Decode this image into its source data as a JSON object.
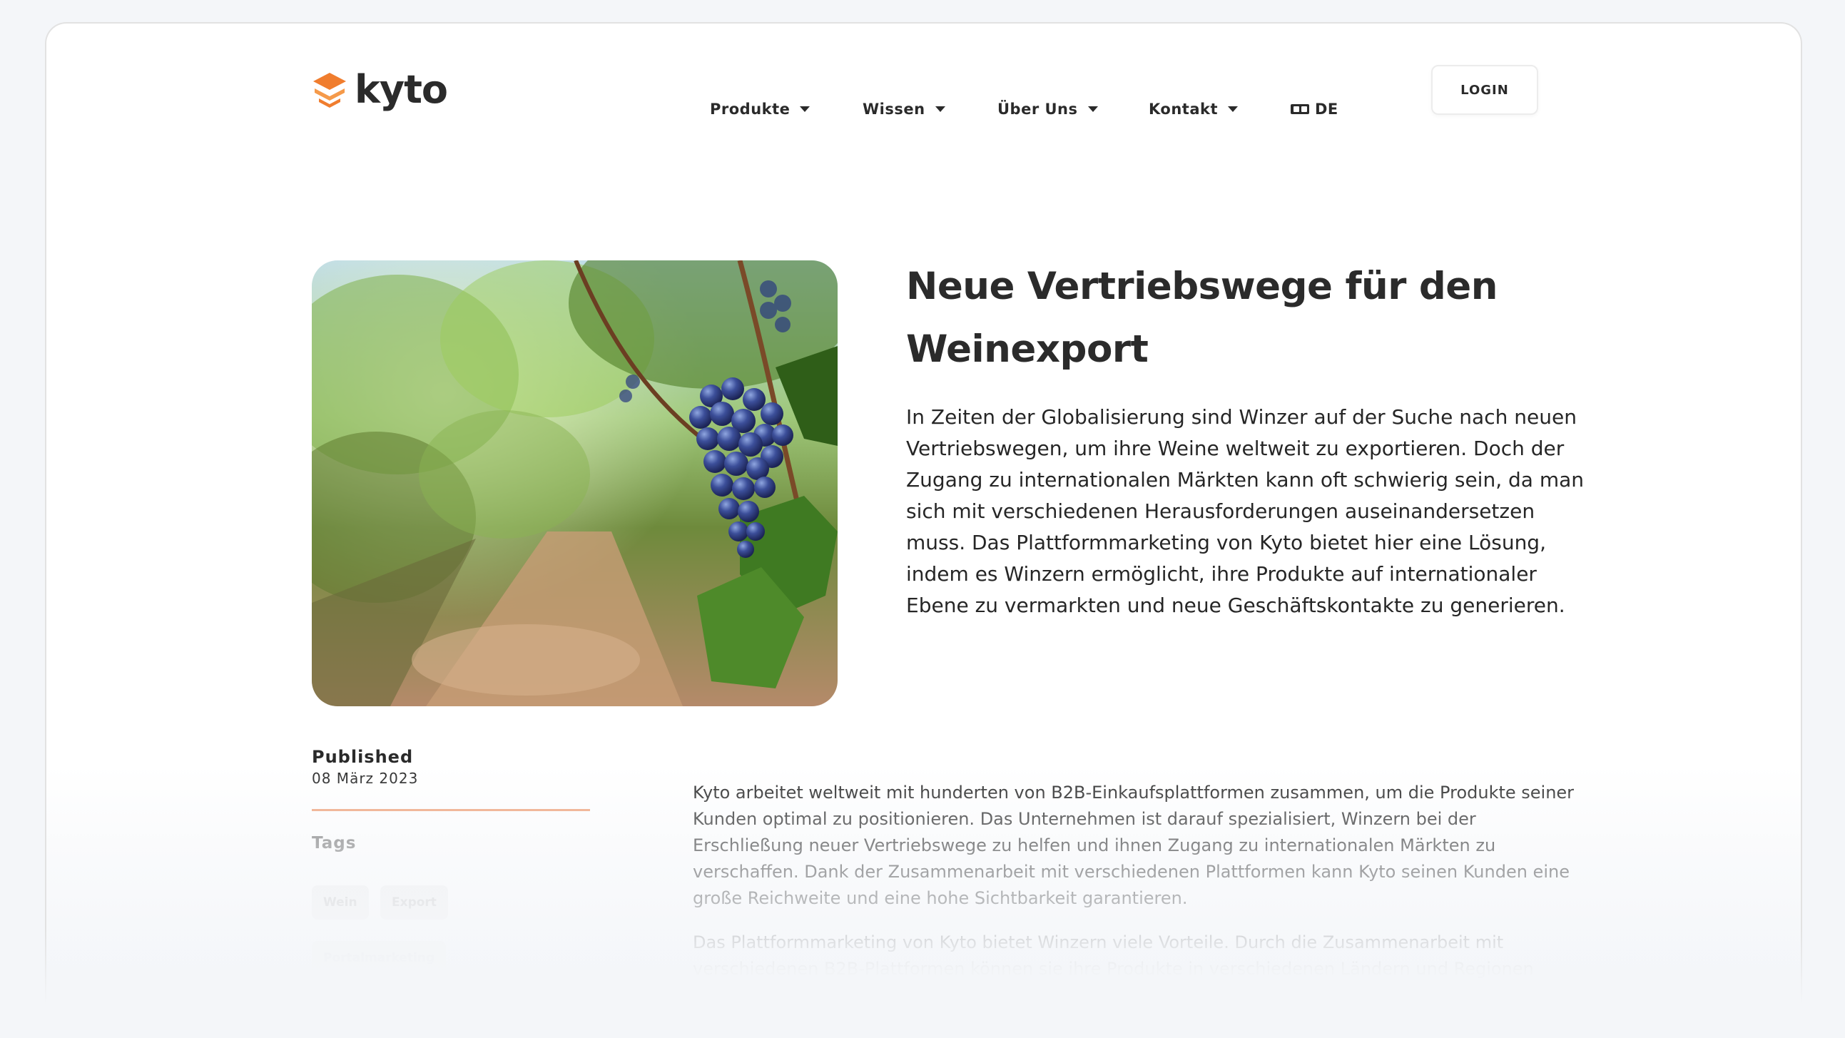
{
  "header": {
    "logo_text": "kyto",
    "nav": [
      {
        "label": "Produkte"
      },
      {
        "label": "Wissen"
      },
      {
        "label": "Über Uns"
      },
      {
        "label": "Kontakt"
      }
    ],
    "language": "DE",
    "login_label": "LOGIN"
  },
  "article": {
    "title": "Neue Vertriebswege für den Weinexport",
    "intro": "In Zeiten der Globalisierung sind Winzer auf der Suche nach neuen Vertriebswegen, um ihre Weine weltweit zu exportieren. Doch der Zugang zu internationalen Märkten kann oft schwierig sein, da man sich mit verschiedenen Herausforderungen auseinandersetzen muss. Das Plattformmarketing von Kyto bietet hier eine Lösung, indem es Winzern ermöglicht, ihre Produkte auf internationaler Ebene zu vermarkten und neue Geschäftskontakte zu generieren.",
    "paragraphs": [
      "Kyto arbeitet weltweit mit hunderten von B2B-Einkaufsplattformen zusammen, um die Produkte seiner Kunden optimal zu positionieren. Das Unternehmen ist darauf spezialisiert, Winzern bei der Erschließung neuer Vertriebswege zu helfen und ihnen Zugang zu internationalen Märkten zu verschaffen. Dank der Zusammenarbeit mit verschiedenen Plattformen kann Kyto seinen Kunden eine große Reichweite und eine hohe Sichtbarkeit garantieren.",
      "Das Plattformmarketing von Kyto bietet Winzern viele Vorteile. Durch die Zusammenarbeit mit verschiedenen B2B-Plattformen können sie ihre Produkte in verschiedenen Ländern und Regionen"
    ]
  },
  "sidebar": {
    "published_label": "Published",
    "published_date": "08 März 2023",
    "tags_label": "Tags",
    "tags": [
      "Wein",
      "Export",
      "Portalmarketing"
    ]
  },
  "colors": {
    "accent": "#f07d2e",
    "accent_light": "#f0a27a",
    "text": "#2b2b2b"
  }
}
